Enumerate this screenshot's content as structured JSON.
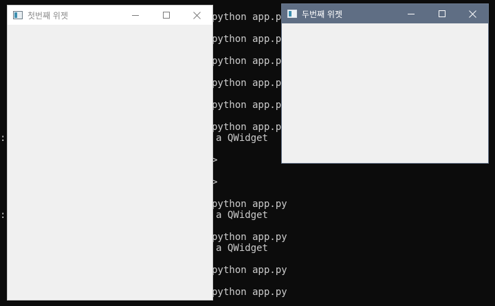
{
  "console": {
    "lines": [
      "python app.p",
      "python app.p",
      "python app.p",
      "python app.p",
      "python app.p",
      "python app.p",
      "a QWidget",
      ">",
      ">",
      "python app.py",
      "a QWidget",
      "python app.py",
      "a QWidget",
      "python app.py",
      "python app.py"
    ],
    "left_marks": [
      ":",
      ":"
    ]
  },
  "windows": {
    "first": {
      "title": "첫번째 위젯",
      "icon": "app-window-icon"
    },
    "second": {
      "title": "두번째 위젯",
      "icon": "app-window-icon"
    }
  },
  "controls": {
    "minimize_icon": "minimize-icon",
    "maximize_icon": "maximize-icon",
    "close_icon": "close-icon"
  },
  "colors": {
    "console_bg": "#0c0c0c",
    "console_text": "#cccccc",
    "active_titlebar": "#5f6e84",
    "inactive_titlebar": "#ffffff",
    "client_bg": "#f0f0f0"
  }
}
